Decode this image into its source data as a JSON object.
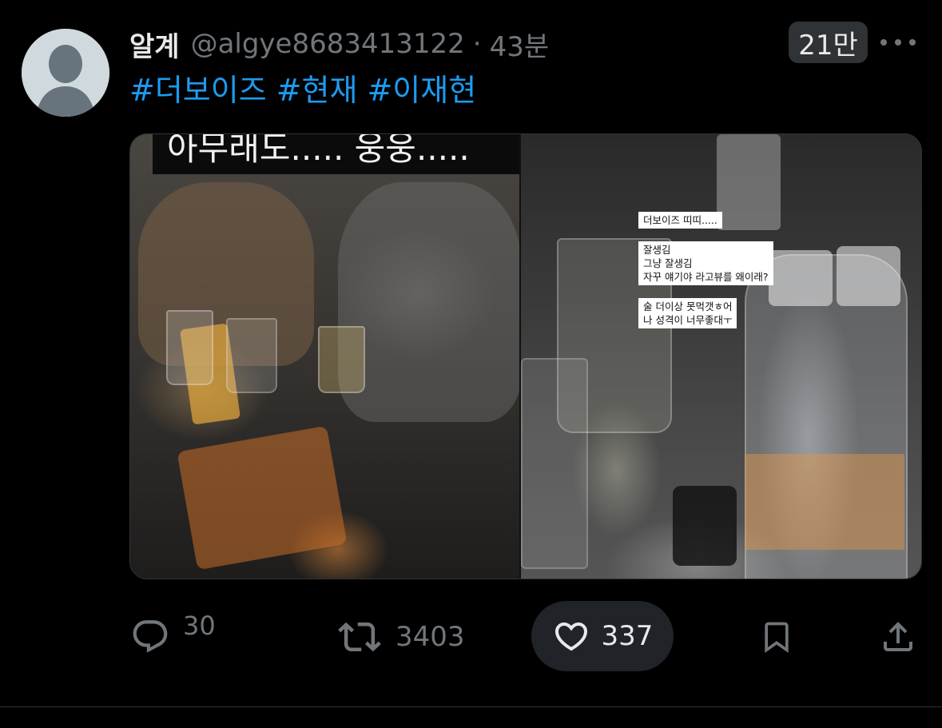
{
  "user": {
    "name": "알계",
    "handle": "@algye8683413122",
    "separator": "·",
    "time": "43분"
  },
  "views": "21만",
  "hashtags": [
    "#더보이즈",
    "#현재",
    "#이재현"
  ],
  "media": {
    "left_caption": "아무래도..... 웅웅.....",
    "right_captions": [
      [
        "더보이즈 띠띠....."
      ],
      [
        "잘생김",
        "그냥 잘생김",
        "자꾸 얘기야 라고뷰를 왜이래?"
      ],
      [
        "술 더이상 못먹갯ㅎ어",
        "나 성격이 너무좋대ㅜ"
      ]
    ]
  },
  "actions": {
    "replies": "30",
    "retweets": "3403",
    "likes": "337"
  },
  "icons": {
    "avatar": "default-avatar-icon",
    "more": "more-horizontal-icon",
    "reply": "reply-icon",
    "retweet": "retweet-icon",
    "like": "heart-icon",
    "bookmark": "bookmark-icon",
    "share": "share-icon"
  },
  "colors": {
    "background": "#000000",
    "link": "#1d9bf0",
    "secondary_text": "#71767b",
    "primary_text": "#e7e9ea"
  }
}
